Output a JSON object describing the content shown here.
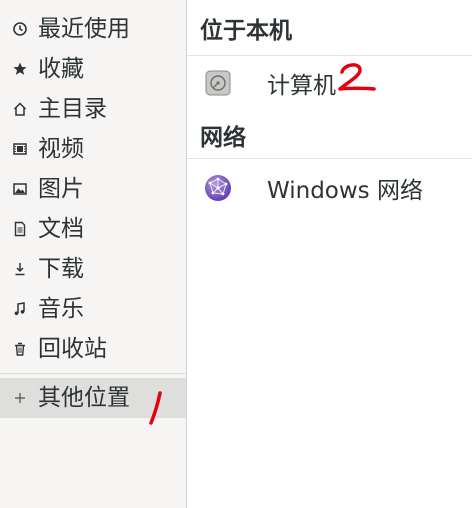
{
  "sidebar": {
    "items": [
      {
        "label": "最近使用",
        "icon": "clock-icon"
      },
      {
        "label": "收藏",
        "icon": "star-icon"
      },
      {
        "label": "主目录",
        "icon": "home-icon"
      },
      {
        "label": "视频",
        "icon": "film-icon"
      },
      {
        "label": "图片",
        "icon": "image-icon"
      },
      {
        "label": "文档",
        "icon": "document-icon"
      },
      {
        "label": "下载",
        "icon": "download-icon"
      },
      {
        "label": "音乐",
        "icon": "music-icon"
      },
      {
        "label": "回收站",
        "icon": "trash-icon"
      }
    ],
    "other_locations": {
      "label": "其他位置",
      "icon": "plus-icon",
      "selected": true
    }
  },
  "main": {
    "on_this_computer": {
      "header": "位于本机",
      "items": [
        {
          "label": "计算机",
          "icon": "harddisk-icon"
        }
      ]
    },
    "networks": {
      "header": "网络",
      "items": [
        {
          "label": "Windows 网络",
          "icon": "network-globe-icon"
        }
      ]
    }
  },
  "annotations": {
    "mark_1": "1",
    "mark_2": "2",
    "color": "#e3000f"
  },
  "colors": {
    "sidebar_bg": "#f6f5f4",
    "selected_bg": "#dededd",
    "text": "#2e3436",
    "globe": "#7e57c2"
  }
}
